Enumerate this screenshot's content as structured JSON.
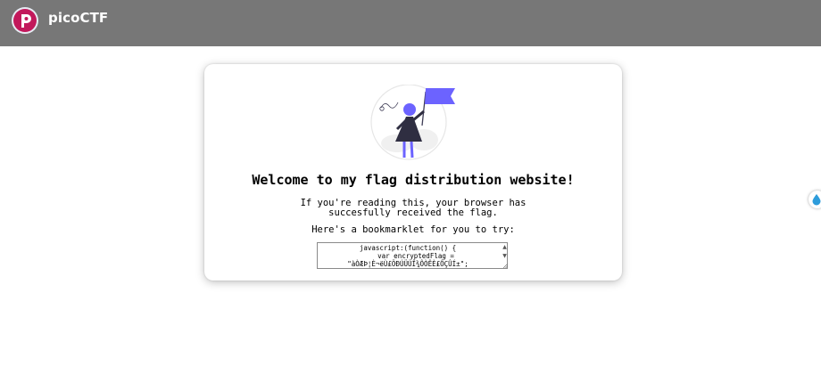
{
  "header": {
    "brand": "picoCTF",
    "logo_icon": "picoctf-logo-icon",
    "background_color": "#777777"
  },
  "main": {
    "illustration_icon": "person-with-flag-illustration",
    "accent_color": "#6c63ff",
    "heading": "Welcome to my flag distribution website!",
    "message_line1": "If you're reading this, your browser has",
    "message_line2": "succesfully received the flag.",
    "bookmarklet_intro": "Here's a bookmarklet for you to try:",
    "bookmarklet_code": "javascript:(function() {\n    var encryptedFlag =\n\"àÒÆÞ¦È¬ëÙ£ÖÐÚÜÙÎ¾ÔÒÊÈ£ÔÇÛÍ±\";"
  },
  "side_widget": {
    "icon": "droplet-icon"
  }
}
